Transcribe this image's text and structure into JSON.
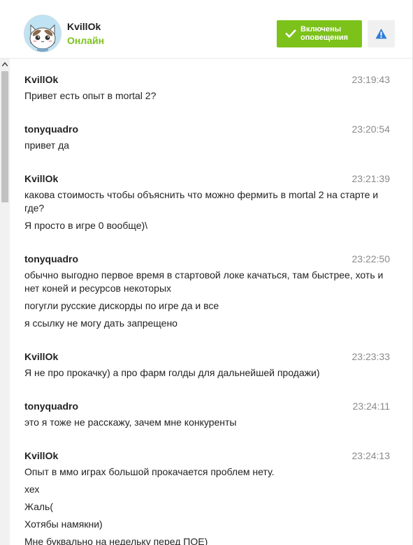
{
  "header": {
    "username": "KvillOk",
    "status": "Онлайн",
    "notify_button": "Включены оповещения",
    "avatar_icon": "cat-avatar-icon",
    "warn_icon": "warning-triangle-icon",
    "accent_color": "#7cc21b"
  },
  "messages": [
    {
      "author": "KvillOk",
      "time": "23:19:43",
      "lines": [
        "Привет есть опыт в mortal 2?"
      ]
    },
    {
      "author": "tonyquadro",
      "time": "23:20:54",
      "lines": [
        "привет да"
      ]
    },
    {
      "author": "KvillOk",
      "time": "23:21:39",
      "lines": [
        "какова стоимость чтобы объяснить что можно фермить в mortal 2 на старте и где?",
        "Я просто в игре 0 вообще)\\"
      ]
    },
    {
      "author": "tonyquadro",
      "time": "23:22:50",
      "lines": [
        "обычно выгодно первое время в стартовой локе качаться, там быстрее, хоть и нет коней и ресурсов некоторых",
        "погугли русские дискорды по игре да и все",
        "я ссылку не могу дать запрещено"
      ]
    },
    {
      "author": "KvillOk",
      "time": "23:23:33",
      "lines": [
        "Я не про прокачку) а про фарм голды для дальнейшей продажи)"
      ]
    },
    {
      "author": "tonyquadro",
      "time": "23:24:11",
      "lines": [
        "это я тоже не расскажу, зачем мне конкуренты"
      ]
    },
    {
      "author": "KvillOk",
      "time": "23:24:13",
      "lines": [
        "Опыт в ммо играх большой прокачается проблем нету.",
        "хех",
        "Жаль(",
        "Хотябы намякни)",
        "Мне буквально на недельку перед ПОЕ)"
      ]
    }
  ]
}
